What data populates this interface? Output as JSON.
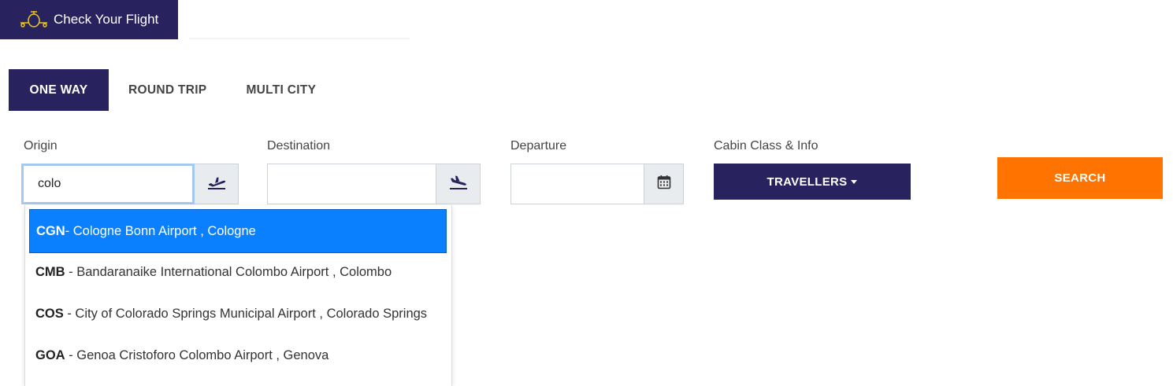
{
  "header": {
    "title": "Check Your Flight",
    "icon": "plane-icon"
  },
  "tabs": [
    {
      "label": "ONE WAY",
      "active": true
    },
    {
      "label": "ROUND TRIP",
      "active": false
    },
    {
      "label": "MULTI CITY",
      "active": false
    }
  ],
  "form": {
    "origin": {
      "label": "Origin",
      "value": "colo",
      "icon": "takeoff-icon"
    },
    "destination": {
      "label": "Destination",
      "value": "",
      "icon": "landing-icon"
    },
    "departure": {
      "label": "Departure",
      "value": "",
      "icon": "calendar-icon"
    },
    "cabin": {
      "label": "Cabin Class & Info",
      "button_label": "TRAVELLERS"
    },
    "search_label": "SEARCH"
  },
  "suggestions": [
    {
      "code": "CGN",
      "text": " - Cologne Bonn Airport , Cologne",
      "highlighted": true
    },
    {
      "code": "CMB",
      "text": " - Bandaranaike International Colombo Airport , Colombo",
      "highlighted": false
    },
    {
      "code": "COS",
      "text": " - City of Colorado Springs Municipal Airport , Colorado Springs",
      "highlighted": false
    },
    {
      "code": "GOA",
      "text": " - Genoa Cristoforo Colombo Airport , Genova",
      "highlighted": false
    }
  ],
  "colors": {
    "primary": "#28235e",
    "accent": "#ff7300",
    "highlight": "#0a80ff"
  }
}
